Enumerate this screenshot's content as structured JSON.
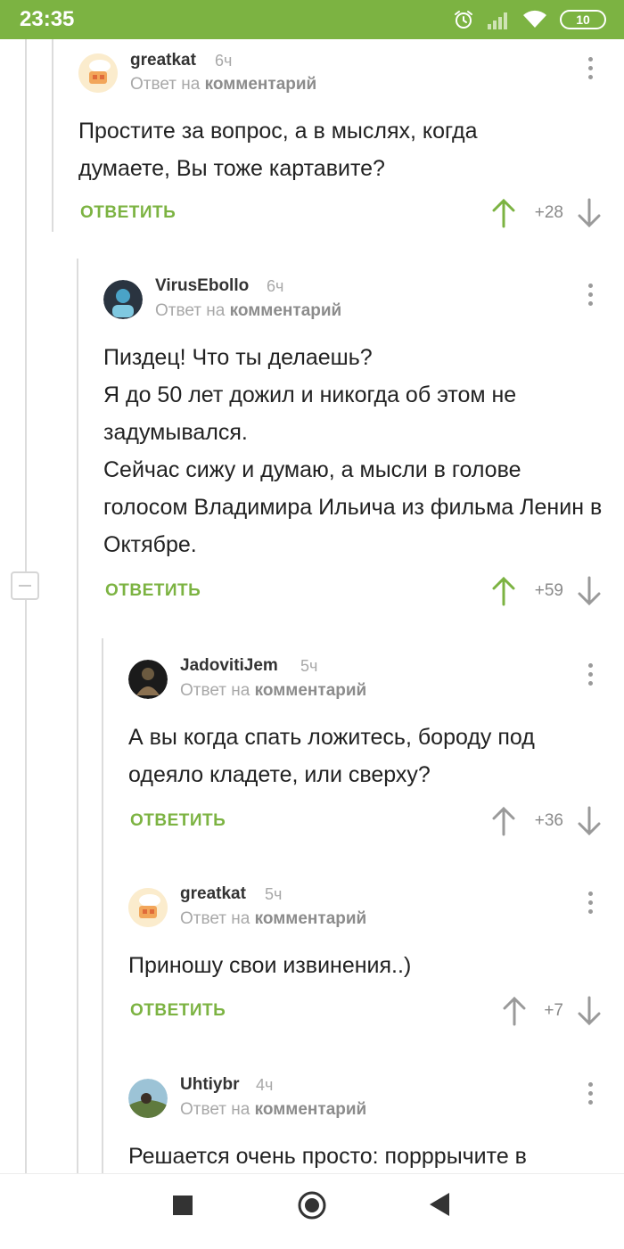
{
  "status_bar": {
    "time": "23:35",
    "icons": [
      "alarm-icon",
      "signal-icon",
      "wifi-icon",
      "battery-icon"
    ],
    "battery_level": "10"
  },
  "colors": {
    "accent_green": "#7cb342",
    "upvote_active": "#7cb342",
    "vote_neutral": "#9a9a9a",
    "meta_gray": "#a8a8a8"
  },
  "comments": [
    {
      "author": "greatkat",
      "time": "6ч",
      "reply_prefix": "Ответ на",
      "reply_link": "комментарий",
      "text": "Простите за вопрос, а в мыслях, когда думаете, Вы тоже картавите?",
      "reply_label": "ОТВЕТИТЬ",
      "score": "+28",
      "upvoted": true
    },
    {
      "author": "VirusEbollo",
      "time": "6ч",
      "reply_prefix": "Ответ на",
      "reply_link": "комментарий",
      "text": "Пиздец! Что ты делаешь?\nЯ до 50 лет дожил и никогда об этом не задумывался.\nСейчас сижу и думаю, а мысли в голове голосом Владимира Ильича  из фильма Ленин в Октябре.",
      "reply_label": "ОТВЕТИТЬ",
      "score": "+59",
      "upvoted": true
    },
    {
      "author": "JadovitiJem",
      "time": "5ч",
      "reply_prefix": "Ответ на",
      "reply_link": "комментарий",
      "text": "А вы когда спать ложитесь, бороду под одеяло кладете, или сверху?",
      "reply_label": "ОТВЕТИТЬ",
      "score": "+36",
      "upvoted": false
    },
    {
      "author": "greatkat",
      "time": "5ч",
      "reply_prefix": "Ответ на",
      "reply_link": "комментарий",
      "text": "Приношу свои извинения..)",
      "reply_label": "ОТВЕТИТЬ",
      "score": "+7",
      "upvoted": false
    },
    {
      "author": "Uhtiybr",
      "time": "4ч",
      "reply_prefix": "Ответ на",
      "reply_link": "комментарий",
      "text": "Решается очень просто: порррычите в"
    }
  ],
  "nav_bar": {
    "icons": [
      "recents-square-icon",
      "home-circle-icon",
      "back-triangle-icon"
    ]
  }
}
